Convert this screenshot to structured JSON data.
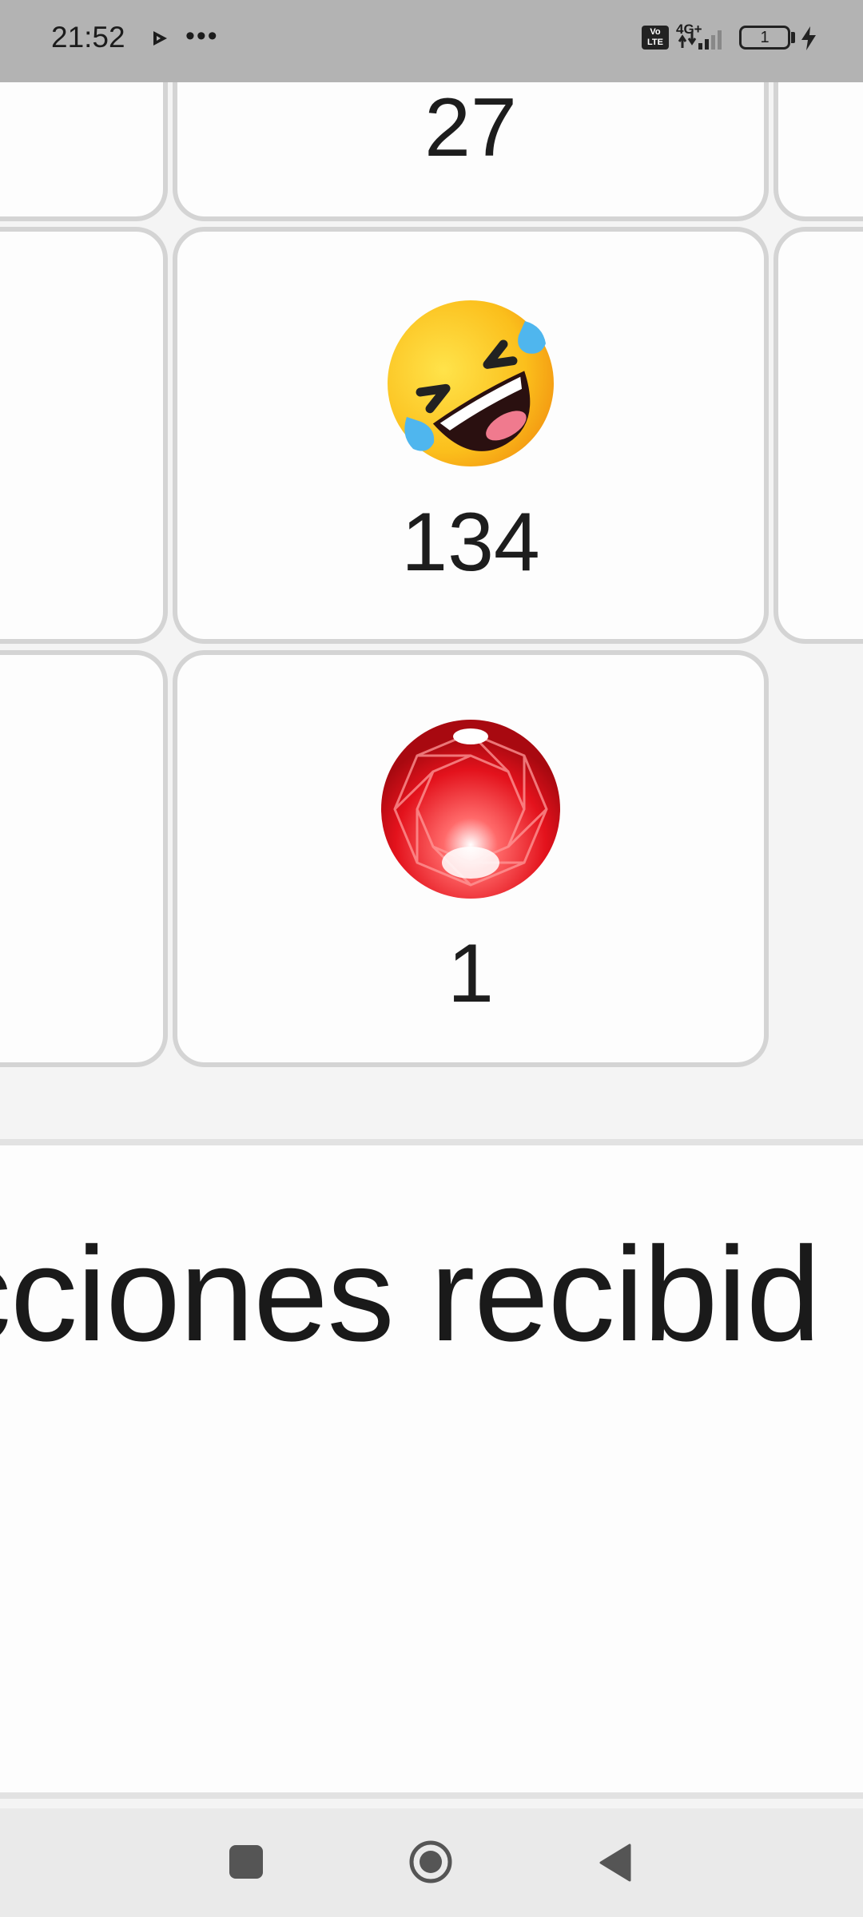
{
  "status_bar": {
    "time": "21:52",
    "network": "4G+",
    "volte_label": "Vo\nLTE",
    "battery_level": "1",
    "icons": [
      "play-icon",
      "more-dots-icon",
      "volte-icon",
      "signal-icon",
      "battery-icon",
      "charging-icon"
    ]
  },
  "reactions": [
    {
      "icon": "",
      "count": "27"
    },
    {
      "icon": "rolling-on-floor-laughing-icon",
      "count": "134"
    },
    {
      "icon": "red-gem-icon",
      "count": "1"
    }
  ],
  "section": {
    "title": "cciones recibid"
  },
  "nav_bar": {
    "icons": [
      "recents-square-icon",
      "home-circle-icon",
      "back-triangle-icon"
    ]
  },
  "colors": {
    "status_bar_bg": "#b3b3b3",
    "page_bg": "#f4f4f4",
    "tile_bg": "#fdfdfd",
    "tile_border": "#d4d4d4",
    "nav_bg": "#eaeaea"
  }
}
